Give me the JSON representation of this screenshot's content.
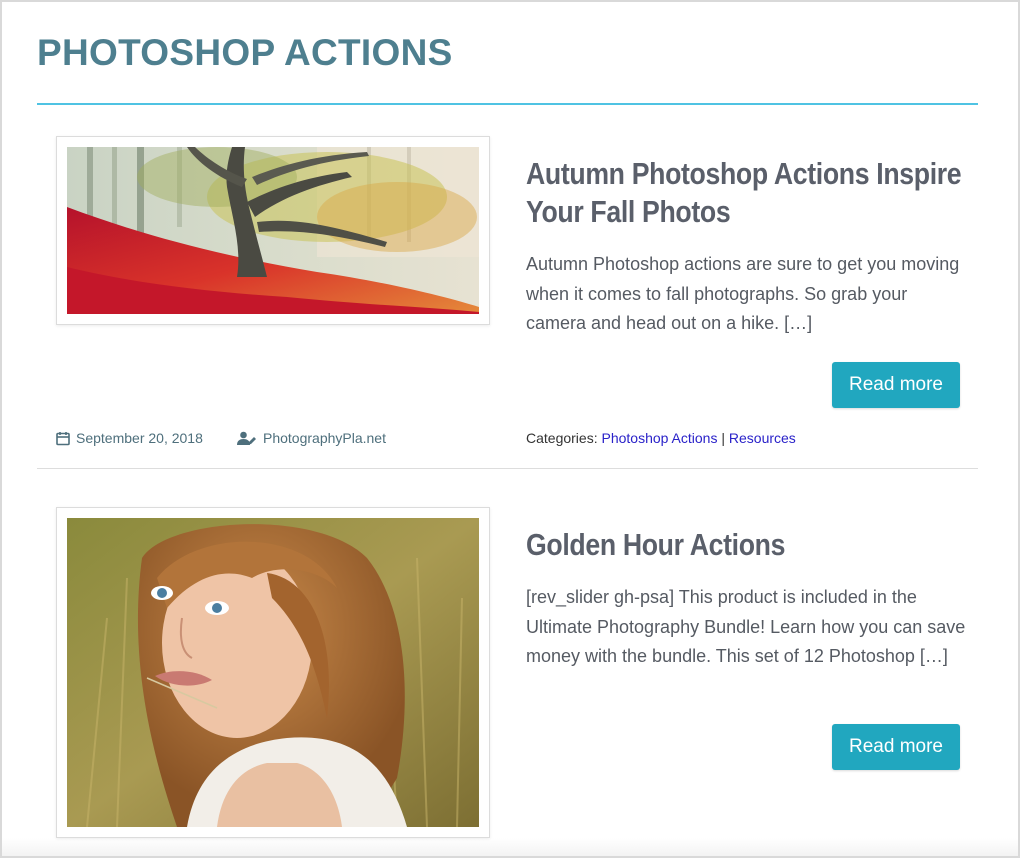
{
  "page": {
    "title": "PHOTOSHOP ACTIONS"
  },
  "colors": {
    "title": "#4e7f8f",
    "rule": "#4fc3e3",
    "button": "#21a7bf",
    "link": "#2a22c9"
  },
  "posts": [
    {
      "title": "Autumn Photoshop Actions Inspire Your Fall Photos",
      "excerpt": "Autumn Photoshop actions are sure to get you moving when it comes to fall photographs. So grab your camera and head out on a hike. […]",
      "read_more": "Read more",
      "date": "September 20, 2018",
      "author": "PhotographyPla.net",
      "categories_label": "Categories:",
      "categories": [
        "Photoshop Actions",
        "Resources"
      ],
      "separator": "|",
      "image": "autumn-forest-photo"
    },
    {
      "title": "Golden Hour Actions",
      "excerpt": "[rev_slider gh-psa] This product is included in the Ultimate Photography Bundle! Learn how you can save money with the bundle. This set of 12 Photoshop […]",
      "read_more": "Read more",
      "image": "golden-hour-portrait-photo"
    }
  ]
}
